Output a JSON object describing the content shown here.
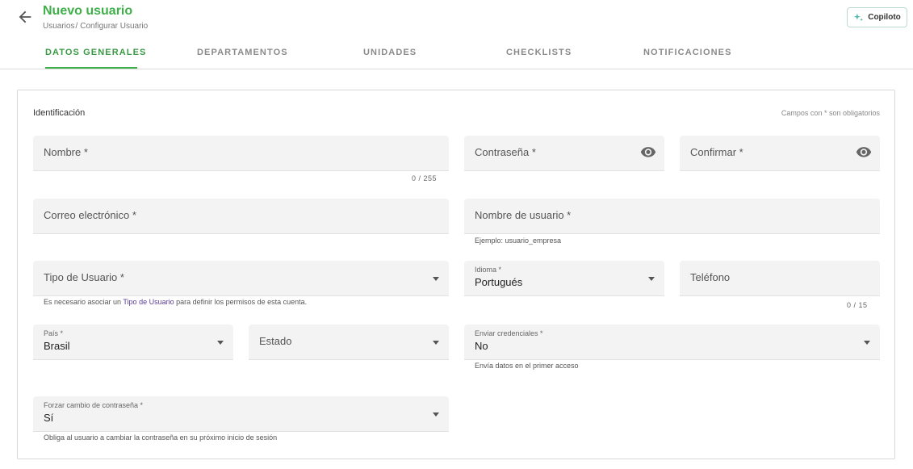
{
  "header": {
    "title": "Nuevo usuario",
    "breadcrumb": {
      "parent": "Usuarios",
      "separator": "/",
      "current": "Configurar Usuario"
    },
    "copilot_label": "Copiloto"
  },
  "tabs": [
    {
      "label": "DATOS GENERALES",
      "active": true
    },
    {
      "label": "DEPARTAMENTOS",
      "active": false
    },
    {
      "label": "UNIDADES",
      "active": false
    },
    {
      "label": "CHECKLISTS",
      "active": false
    },
    {
      "label": "NOTIFICACIONES",
      "active": false
    }
  ],
  "form": {
    "section_title": "Identificación",
    "required_note": "Campos con * son obligatorios",
    "nombre": {
      "label": "Nombre *",
      "counter": "0 / 255"
    },
    "contrasena": {
      "label": "Contraseña *"
    },
    "confirmar": {
      "label": "Confirmar *"
    },
    "correo": {
      "label": "Correo electrónico *"
    },
    "nombre_usuario": {
      "label": "Nombre de usuario *",
      "hint": "Ejemplo: usuario_empresa"
    },
    "tipo_usuario": {
      "label": "Tipo de Usuario *",
      "hint_before": "Es necesario asociar un ",
      "hint_link": "Tipo de Usuario",
      "hint_after": " para definir los permisos de esta cuenta."
    },
    "idioma": {
      "label": "Idioma *",
      "value": "Portugués"
    },
    "telefono": {
      "label": "Teléfono",
      "counter": "0 / 15"
    },
    "pais": {
      "label": "País *",
      "value": "Brasil"
    },
    "estado": {
      "label": "Estado"
    },
    "enviar_credenciales": {
      "label": "Enviar credenciales *",
      "value": "No",
      "hint": "Envía datos en el primer acceso"
    },
    "forzar_cambio": {
      "label": "Forzar cambio de contraseña *",
      "value": "Sí",
      "hint": "Obliga al usuario a cambiar la contraseña en su próximo inicio de sesión"
    }
  },
  "colors": {
    "accent": "#3faf4a",
    "link": "#5a3a9a",
    "field_bg": "#f3f3f3"
  },
  "icons": {
    "back": "arrow-left-icon",
    "copilot": "sparkle-icon",
    "password_toggle": "eye-icon",
    "dropdown": "caret-down-icon"
  }
}
